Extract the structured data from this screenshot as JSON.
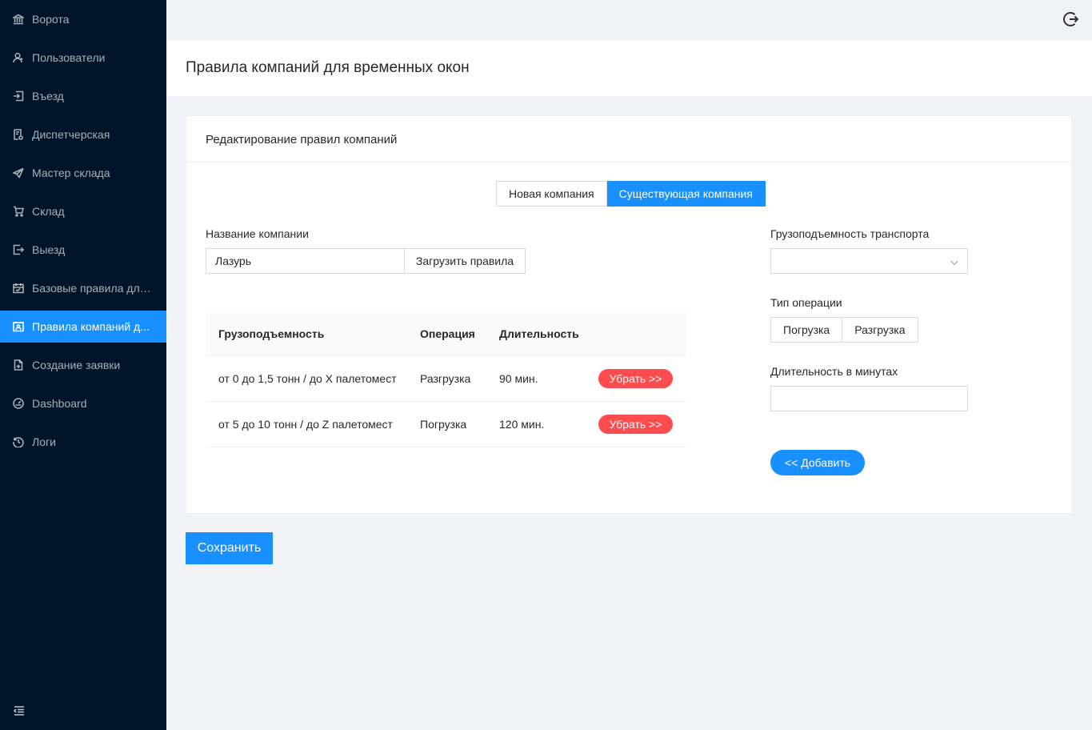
{
  "sidebar": {
    "items": [
      {
        "label": "Ворота",
        "icon": "bank-icon",
        "active": false
      },
      {
        "label": "Пользователи",
        "icon": "users-icon",
        "active": false
      },
      {
        "label": "Въезд",
        "icon": "login-icon",
        "active": false
      },
      {
        "label": "Диспетчерская",
        "icon": "audit-icon",
        "active": false
      },
      {
        "label": "Мастер склада",
        "icon": "send-icon",
        "active": false
      },
      {
        "label": "Склад",
        "icon": "cart-icon",
        "active": false
      },
      {
        "label": "Выезд",
        "icon": "logout-icon",
        "active": false
      },
      {
        "label": "Базовые правила для ...",
        "icon": "schedule-icon",
        "active": false
      },
      {
        "label": "Правила компаний д...",
        "icon": "contacts-icon",
        "active": true
      },
      {
        "label": "Создание заявки",
        "icon": "file-add-icon",
        "active": false
      },
      {
        "label": "Dashboard",
        "icon": "dashboard-icon",
        "active": false
      },
      {
        "label": "Логи",
        "icon": "history-icon",
        "active": false
      }
    ]
  },
  "header": {
    "title": "Правила компаний для временных окон"
  },
  "card": {
    "title": "Редактирование правил компаний",
    "mode_tabs": [
      {
        "label": "Новая компания",
        "active": false
      },
      {
        "label": "Существующая компания",
        "active": true
      }
    ],
    "company_label": "Название компании",
    "company_value": "Лазурь",
    "load_rules_label": "Загрузить правила",
    "table": {
      "headers": [
        "Грузоподъемность",
        "Операция",
        "Длительность"
      ],
      "rows": [
        {
          "capacity": "от 0 до 1,5 тонн / до X палетомест",
          "operation": "Разгрузка",
          "duration": "90 мин.",
          "action": "Убрать >>"
        },
        {
          "capacity": "от 5 до 10 тонн / до Z палетомест",
          "operation": "Погрузка",
          "duration": "120 мин.",
          "action": "Убрать >>"
        }
      ]
    },
    "capacity_label": "Грузоподъемность транспорта",
    "capacity_value": "",
    "operation_type_label": "Тип операции",
    "operation_options": [
      "Погрузка",
      "Разгрузка"
    ],
    "duration_label": "Длительность в минутах",
    "duration_value": "",
    "add_label": "<< Добавить"
  },
  "save_label": "Сохранить",
  "colors": {
    "primary": "#1890ff",
    "danger": "#ff4d4f",
    "sidebar_bg": "#001529"
  }
}
